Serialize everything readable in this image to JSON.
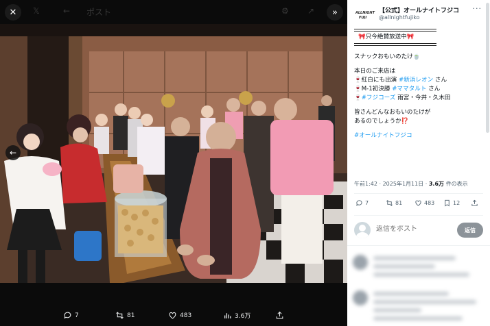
{
  "viewer": {
    "close_icon": "close-icon",
    "expand_icon": "chevrons-right-icon",
    "prev_icon": "arrow-left-icon",
    "faint_header": "ポスト",
    "actions": {
      "replies": "7",
      "reposts": "81",
      "likes": "483",
      "views": "3.6万"
    }
  },
  "panel": {
    "account": {
      "logo_text": "ALL NIGHT FUJI",
      "name": "【公式】オールナイトフジコ",
      "handle": "@allnightfujiko",
      "more": "···"
    },
    "post": {
      "banner": "🎀只今絶賛放送中🎀",
      "line1": "スナックおもいのたけ🍵",
      "line2": "本日のご来店は",
      "line3_prefix": "🍷紅白にも出演 ",
      "line3_tag": "#新浜レオン",
      "line3_suffix": " さん",
      "line4_prefix": "🍷M-1初決勝 ",
      "line4_tag": "#ママタルト",
      "line4_suffix": " さん",
      "line5_prefix": "🍷",
      "line5_tag": "#フジコーズ",
      "line5_suffix": " 雨宮・今井・久木田",
      "line6": "皆さんどんなおもいのたけが",
      "line7": "あるのでしょうか⁉️",
      "hashtag": "#オールナイトフジコ"
    },
    "meta": {
      "time": "午前1:42 · 2025年1月11日 · ",
      "views": "3.6万",
      "views_label": " 件の表示"
    },
    "stats": {
      "replies": "7",
      "reposts": "81",
      "likes": "483",
      "bookmarks": "12"
    },
    "reply": {
      "placeholder": "返信をポスト",
      "button": "返信"
    }
  }
}
